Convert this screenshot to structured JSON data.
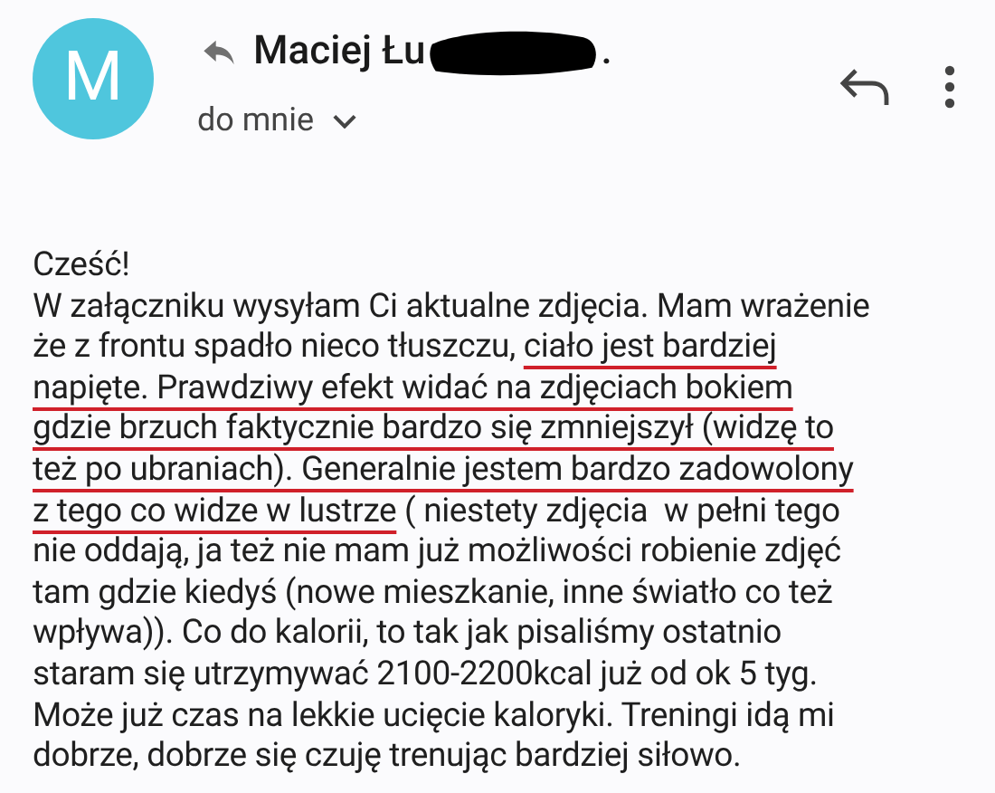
{
  "sender": {
    "avatar_letter": "M",
    "name_start": "Maciej Łu",
    "redacted": true,
    "name_end": ".",
    "replied": true
  },
  "recipient": "do mnie",
  "body": [
    {
      "segments": [
        {
          "text": "Cześć!",
          "underlined": false
        }
      ]
    },
    {
      "segments": [
        {
          "text": "W załączniku wysyłam Ci aktualne zdjęcia. Mam wrażenie",
          "underlined": false
        }
      ]
    },
    {
      "segments": [
        {
          "text": "że z frontu spadło nieco tłuszczu, ",
          "underlined": false
        },
        {
          "text": "ciało jest bardziej",
          "underlined": true
        }
      ]
    },
    {
      "segments": [
        {
          "text": "napięte. Prawdziwy efekt widać na zdjęciach bokiem",
          "underlined": true
        }
      ]
    },
    {
      "segments": [
        {
          "text": "gdzie brzuch faktycznie bardzo się zmniejszył (widzę to",
          "underlined": true
        }
      ]
    },
    {
      "segments": [
        {
          "text": "też po ubraniach). Generalnie jestem bardzo zadowolony",
          "underlined": true
        }
      ]
    },
    {
      "segments": [
        {
          "text": "z tego co widze w lustrze",
          "underlined": true
        },
        {
          "text": " ( niestety zdjęcia  w pełni tego",
          "underlined": false
        }
      ]
    },
    {
      "segments": [
        {
          "text": "nie oddają, ja też nie mam już możliwości robienie zdjęć",
          "underlined": false
        }
      ]
    },
    {
      "segments": [
        {
          "text": "tam gdzie kiedyś (nowe mieszkanie, inne światło co też",
          "underlined": false
        }
      ]
    },
    {
      "segments": [
        {
          "text": "wpływa)). Co do kalorii, to tak jak pisaliśmy ostatnio",
          "underlined": false
        }
      ]
    },
    {
      "segments": [
        {
          "text": "staram się utrzymywać 2100-2200kcal już od ok 5 tyg.",
          "underlined": false
        }
      ]
    },
    {
      "segments": [
        {
          "text": "Może już czas na lekkie ucięcie kaloryki. Treningi idą mi",
          "underlined": false
        }
      ]
    },
    {
      "segments": [
        {
          "text": "dobrze, dobrze się czuję trenując bardziej siłowo.",
          "underlined": false
        }
      ]
    }
  ]
}
